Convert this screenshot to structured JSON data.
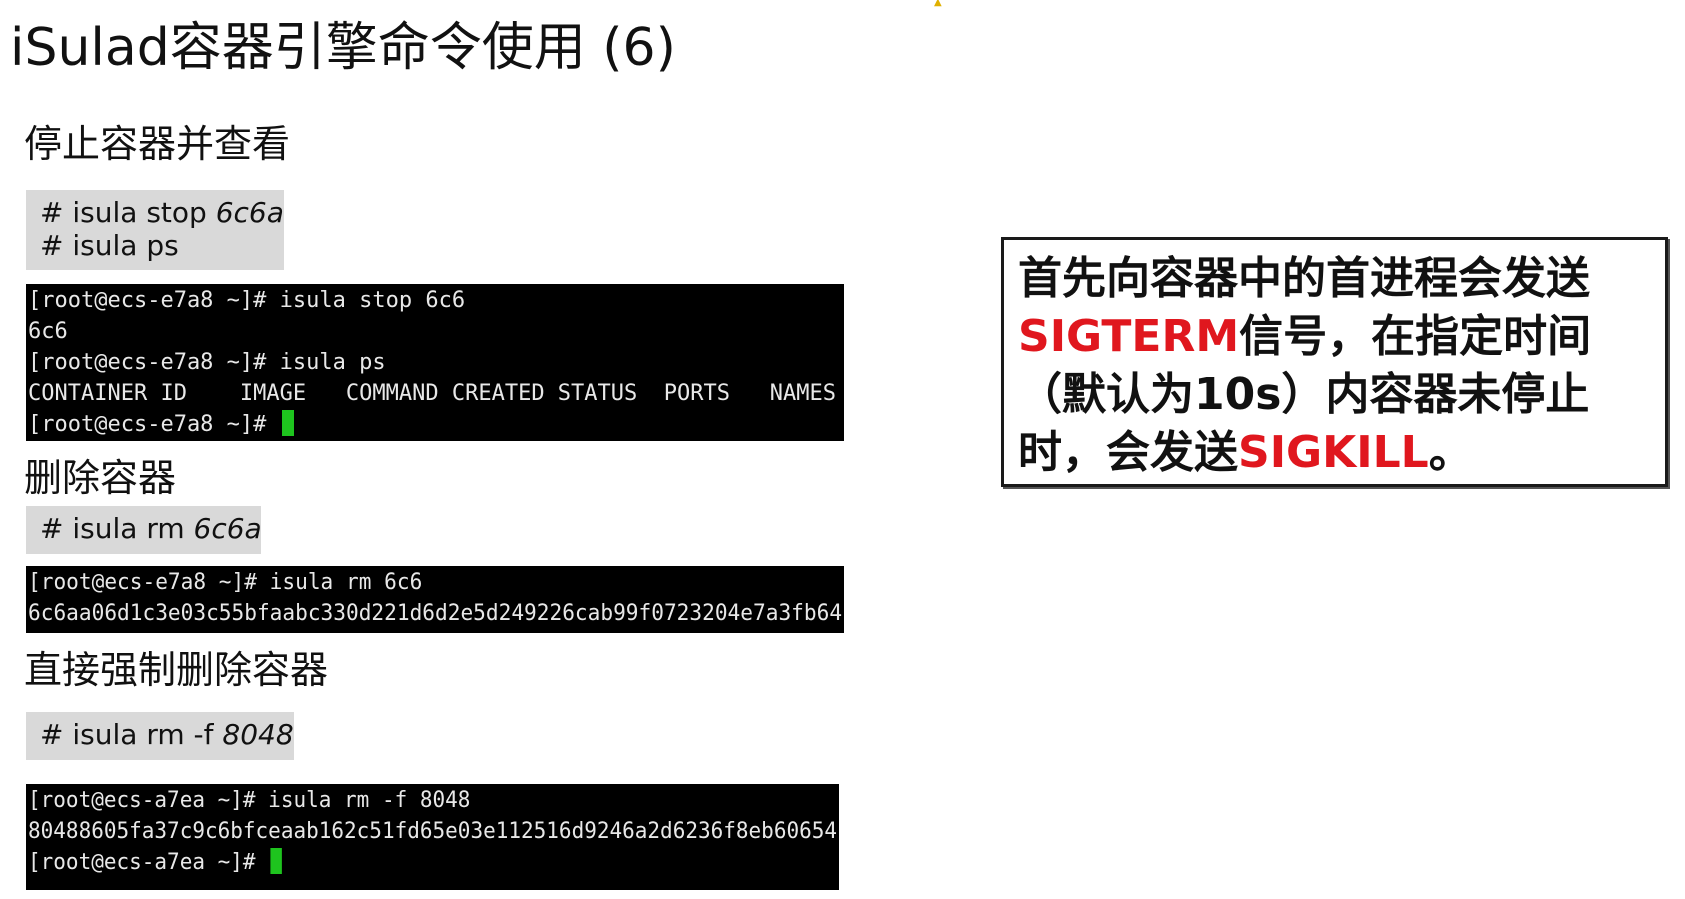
{
  "slide": {
    "title": "iSulad容器引擎命令使用 (6)"
  },
  "sections": [
    {
      "heading": "停止容器并查看",
      "commands": [
        {
          "prefix": "# isula stop ",
          "arg": "6c6a"
        },
        {
          "prefix": "# isula ps",
          "arg": ""
        }
      ],
      "terminal": [
        "[root@ecs-e7a8 ~]# isula stop 6c6",
        "6c6",
        "[root@ecs-e7a8 ~]# isula ps",
        "CONTAINER ID    IMAGE   COMMAND CREATED STATUS  PORTS   NAMES",
        "[root@ecs-e7a8 ~]# "
      ]
    },
    {
      "heading": "删除容器",
      "commands": [
        {
          "prefix": "# isula rm ",
          "arg": "6c6a"
        }
      ],
      "terminal": [
        "[root@ecs-e7a8 ~]# isula rm 6c6",
        "6c6aa06d1c3e03c55bfaabc330d221d6d2e5d249226cab99f0723204e7a3fb64"
      ]
    },
    {
      "heading": "直接强制删除容器",
      "commands": [
        {
          "prefix": "# isula rm -f ",
          "arg": "8048"
        }
      ],
      "terminal": [
        "[root@ecs-a7ea ~]# isula rm -f 8048",
        "80488605fa37c9c6bfceaab162c51fd65e03e112516d9246a2d6236f8eb60654",
        "[root@ecs-a7ea ~]# "
      ]
    }
  ],
  "note": {
    "part1": "首先向容器中的首进程会发送",
    "signal1": "SIGTERM",
    "part2": "信号，在指定时间（默认为10s）内容器未停止时，会发送",
    "signal2": "SIGKILL",
    "part3": "。",
    "accent_color": "#e0171e"
  },
  "icons": {
    "mouse_cursor": "mouse-pointer-icon",
    "terminal_cursor": "terminal-block-cursor-icon"
  },
  "colors": {
    "terminal_bg": "#000000",
    "terminal_fg": "#e8e8e8",
    "cursor_green": "#1ec41e",
    "command_box_bg": "#d9d9d9"
  }
}
